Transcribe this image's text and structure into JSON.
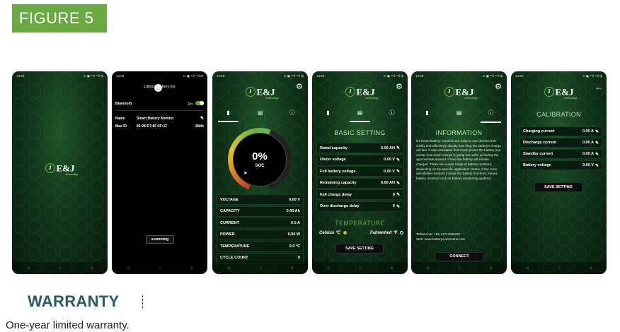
{
  "banner": {
    "label": "FIGURE 5"
  },
  "status": {
    "time": "13:59",
    "icons": "⊙ ▣ ⁵⁵il ⁵⁵il ⊞"
  },
  "navbar": {
    "back": "◁",
    "home": "○",
    "recents": "≡"
  },
  "logo": {
    "mark": "J",
    "text": "E&J",
    "sub": "technology"
  },
  "icons": {
    "gear": "gear-icon",
    "info": "info-icon",
    "battery": "battery-icon",
    "list": "list-icon",
    "back": "back-arrow-icon",
    "pencil": "pencil-icon"
  },
  "screen1": {},
  "screen2": {
    "header": "Lithium battery list",
    "bluetooth_label": "Bluetooth",
    "bluetooth_state": "On",
    "name_key": "Name",
    "name_value": "Smart Battery Monitor",
    "mac_key": "Mac ID",
    "mac_value": "84:28:D7:8F:0F:1F",
    "rssi": "-68db",
    "scan_button": "scanning"
  },
  "screen3": {
    "gauge_percent": "0%",
    "gauge_label": "SOC",
    "soc_value": 0,
    "rows": [
      {
        "label": "VOLTAGE",
        "value": "0.00 V"
      },
      {
        "label": "CAPACITY",
        "value": "0.00 Ah"
      },
      {
        "label": "CURRENT",
        "value": "0.0 A"
      },
      {
        "label": "POWER",
        "value": "0.00 W"
      },
      {
        "label": "TEMPERATURE",
        "value": "0.0 ℃"
      },
      {
        "label": "CYCLE COUNT",
        "value": "0"
      }
    ]
  },
  "screen4": {
    "title": "BASIC SETTING",
    "rows": [
      {
        "label": "Rated capacity",
        "value": "0.00 AH"
      },
      {
        "label": "Under voltage",
        "value": "0.00 V"
      },
      {
        "label": "Full battery voltage",
        "value": "0.00 V"
      },
      {
        "label": "Remaining capacity",
        "value": "0.00 AH"
      },
      {
        "label": "Full charge delay",
        "value": "0"
      },
      {
        "label": "Over discharge delay",
        "value": "0"
      }
    ],
    "temp_title": "TEMPERATURE",
    "celsius": "Celsius ℃",
    "fahrenheit": "Fahrenheit ℉",
    "save_button": "SAVE SETTING"
  },
  "screen5": {
    "title": "INFORMATION",
    "para1": "EJ Smart Battery monitors are easy-to-use devices that visibly and effectively display how long the battery's charge will last. It also calculates how much power the battery has versus how much charge is going out, while providing the approximate amount of time the battery will remain charged. There are a wide range of battery monitors, depending on the specific application. Some of the more identifiable monitors include RV battery monitors, marine battery monitors and car battery monitoring systems.",
    "tel": "Tel/Wechat: +86-13714898007",
    "web": "Web: www.batterycoulometer.com",
    "connect_button": "CONNECT"
  },
  "screen6": {
    "title": "CALIBRATION",
    "rows": [
      {
        "label": "Charging current",
        "value": "0.00 A"
      },
      {
        "label": "Discharge current",
        "value": "0.00 A"
      },
      {
        "label": "Standby current",
        "value": "0.00 A"
      },
      {
        "label": "Battery voltage",
        "value": "0.00 V"
      }
    ],
    "save_button": "SAVE SETTING"
  },
  "warranty": {
    "title": "WARRANTY",
    "text": "One-year limited warranty."
  }
}
